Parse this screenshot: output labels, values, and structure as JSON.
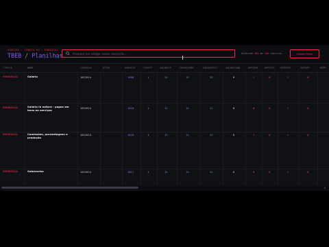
{
  "header": {
    "brand_sub_left": "ESOCIAL",
    "brand_sub_mid": "TABELA 03",
    "brand_sub_right": "RUBRICAS",
    "brand_title_left": "TBEB",
    "brand_title_sep": "/",
    "brand_title_right": "Planilhas",
    "search_placeholder": "Pesquise por código, nome, descrição...",
    "filter_prefix": "Exibindo",
    "filter_count": "104",
    "filter_mid": "de",
    "filter_total": "104",
    "filter_suffix": "rubricas",
    "clear_label": "Limpar filtros"
  },
  "columns": [
    "TIPO/E",
    "NOME",
    "VIGÊNCIA",
    "ATIVO",
    "RUBRICA",
    "TIPOCP",
    "CODINCCP",
    "CODINCIRRF",
    "CODINCFGTS",
    "CODINCSIND",
    "REPIRRF",
    "REPFGTS",
    "REPPREV",
    "REPGRF",
    "REPR"
  ],
  "rows": [
    {
      "tipo": "REMUNERAÇÃO",
      "nome": "Salário",
      "vig": "1012014",
      "rub": "1000",
      "tp": "1",
      "inccp": "11",
      "incirrf": "11",
      "incfgts": "11",
      "incsind": "0",
      "r1": "1",
      "r2": "0",
      "r3": "1",
      "r4": "0"
    },
    {
      "tipo": "REMUNERAÇÃO",
      "nome": "Salário in natura - pagos em bens ou serviços",
      "vig": "1012014",
      "rub": "1010",
      "tp": "1",
      "inccp": "11",
      "incirrf": "11",
      "incfgts": "11",
      "incsind": "0",
      "r1": "0",
      "r2": "0",
      "r3": "1",
      "r4": "0"
    },
    {
      "tipo": "REMUNERAÇÃO",
      "nome": "Comissões, porcentagens e produção",
      "vig": "1012014",
      "rub": "1020",
      "tp": "1",
      "inccp": "11",
      "incirrf": "11",
      "incfgts": "11",
      "incsind": "0",
      "r1": "1",
      "r2": "0",
      "r3": "1",
      "r4": "0"
    },
    {
      "tipo": "REMUNERAÇÃO",
      "nome": "Sobreaviso",
      "vig": "1012014",
      "rub": "1011",
      "tp": "1",
      "inccp": "11",
      "incirrf": "11",
      "incfgts": "11",
      "incsind": "0",
      "r1": "0",
      "r2": "0",
      "r3": "1",
      "r4": "0"
    }
  ],
  "colors": {
    "accent": "#ff2a4a",
    "brand": "#8b5cf6",
    "background": "#101114"
  }
}
